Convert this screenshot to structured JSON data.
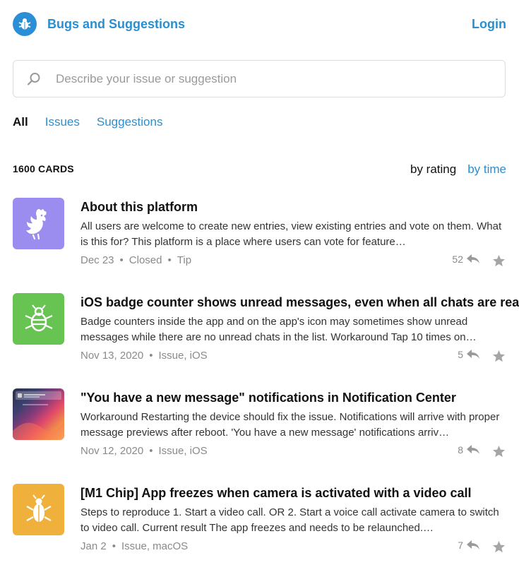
{
  "header": {
    "title": "Bugs and Suggestions",
    "login_label": "Login"
  },
  "search": {
    "placeholder": "Describe your issue or suggestion",
    "value": ""
  },
  "tabs": [
    {
      "label": "All",
      "active": true
    },
    {
      "label": "Issues",
      "active": false
    },
    {
      "label": "Suggestions",
      "active": false
    }
  ],
  "list_header": {
    "count": "1600 CARDS",
    "sort_rating": "by rating",
    "sort_time": "by time",
    "active_sort": "by time"
  },
  "colors": {
    "accent": "#2a8fd1",
    "logo_bg": "#2b8fd6",
    "thumb_purple": "#9b8cf0",
    "thumb_green": "#67c352",
    "thumb_yellow": "#f0b03c"
  },
  "cards": [
    {
      "icon": "rooster-icon",
      "title": "About this platform",
      "description": "All users are welcome to create new entries, view existing entries and vote on them. What is this for? This platform is a place where users can vote for feature…",
      "date": "Dec 23",
      "tags": "Closed",
      "extra": "Tip",
      "replies": "52"
    },
    {
      "icon": "bug-icon",
      "title": "iOS badge counter shows unread messages, even when all chats are read",
      "description": "Badge counters inside the app and on the app's icon may sometimes show unread messages while there are no unread chats in the list. Workaround Tap 10 times on…",
      "date": "Nov 13, 2020",
      "tags": "Issue, iOS",
      "extra": "",
      "replies": "5"
    },
    {
      "icon": "screenshot-thumbnail",
      "title": "\"You have a new message\" notifications in Notification Center",
      "description": "Workaround Restarting the device should fix the issue. Notifications will arrive with proper message previews after reboot. 'You have a new message' notifications arriv…",
      "date": "Nov 12, 2020",
      "tags": "Issue, iOS",
      "extra": "",
      "replies": "8"
    },
    {
      "icon": "bug-icon",
      "title": "[M1 Chip] App freezes when camera is activated with a video call",
      "description": "Steps to reproduce 1. Start a video call. OR 2. Start a voice call activate camera to switch to video call. Current result The app freezes and needs to be relaunched.…",
      "date": "Jan 2",
      "tags": "Issue, macOS",
      "extra": "",
      "replies": "7"
    }
  ]
}
